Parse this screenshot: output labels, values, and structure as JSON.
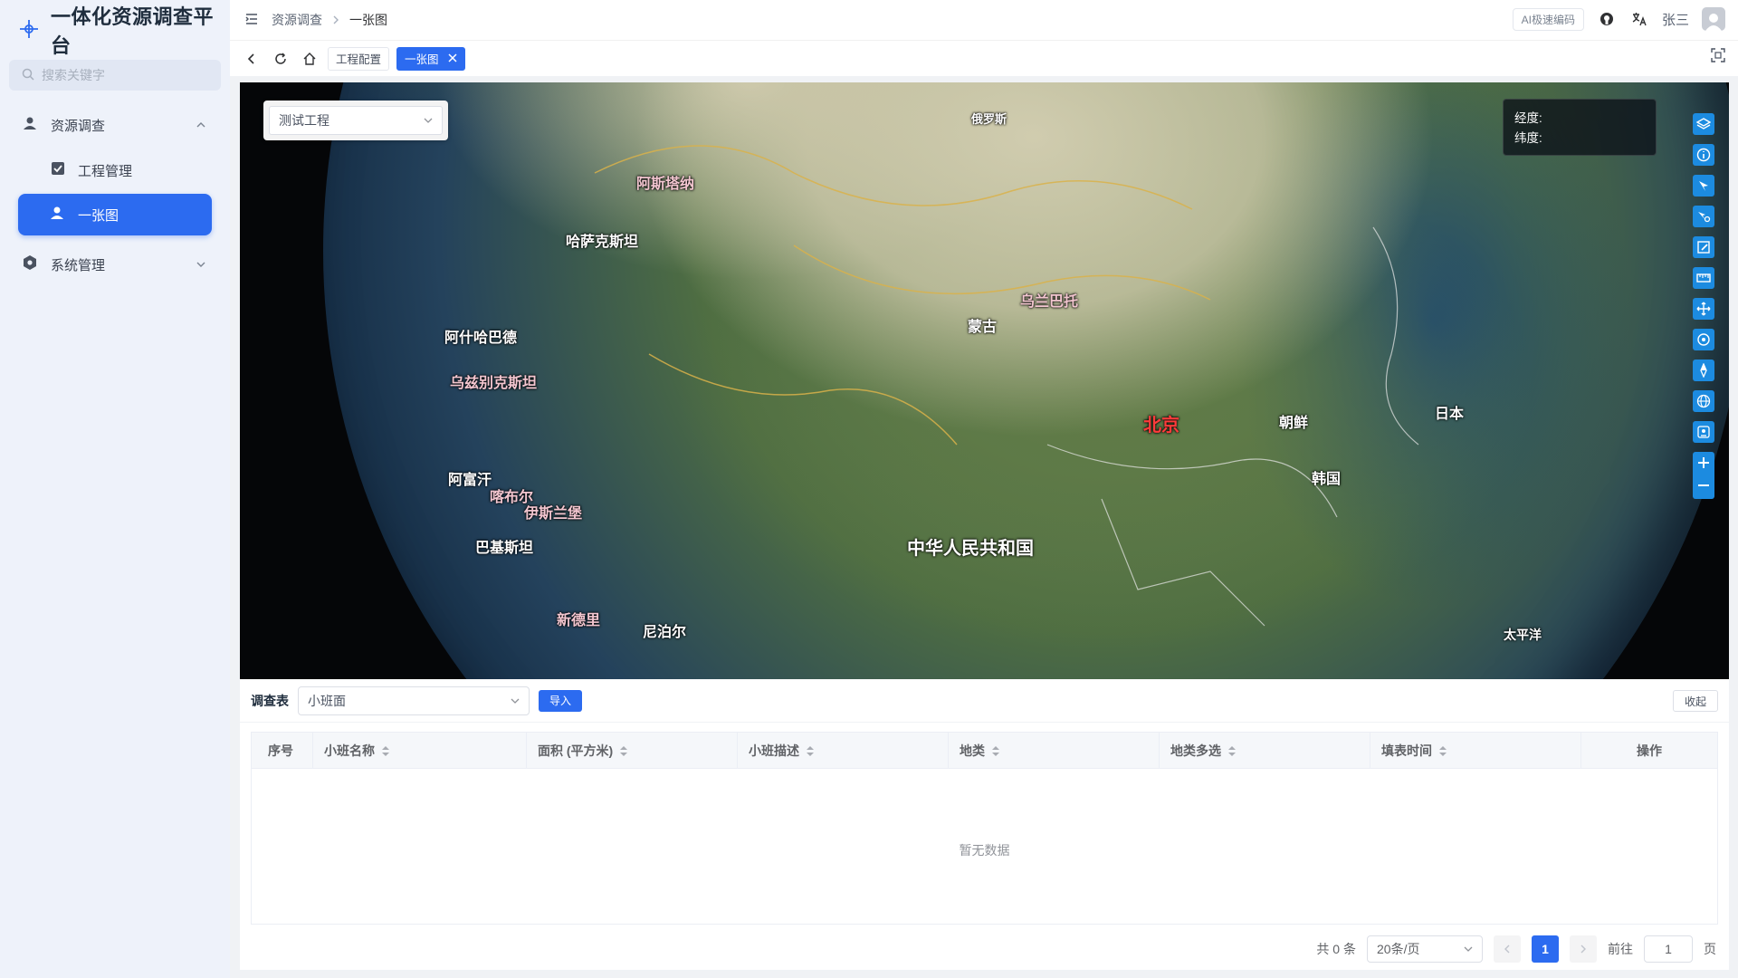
{
  "app": {
    "title": "一体化资源调查平台"
  },
  "sidebar": {
    "search_placeholder": "搜索关键字",
    "items": [
      {
        "label": "资源调查",
        "icon": "user-map-icon"
      },
      {
        "label": "工程管理",
        "icon": "check-square-icon"
      },
      {
        "label": "一张图",
        "icon": "user-map-icon",
        "active": true
      },
      {
        "label": "系统管理",
        "icon": "gear-icon"
      }
    ]
  },
  "header": {
    "breadcrumb": [
      "资源调查",
      "一张图"
    ],
    "ai_badge": "AI极速编码",
    "user_name": "张三"
  },
  "tabs": [
    {
      "label": "工程配置"
    },
    {
      "label": "一张图",
      "active": true
    }
  ],
  "map": {
    "project_select": "测试工程",
    "coords": {
      "lng_label": "经度:",
      "lat_label": "纬度:"
    },
    "labels": [
      {
        "text": "俄罗斯"
      },
      {
        "text": "乌兰巴托"
      },
      {
        "text": "蒙古"
      },
      {
        "text": "北京"
      },
      {
        "text": "朝鲜"
      },
      {
        "text": "韩国"
      },
      {
        "text": "日本"
      },
      {
        "text": "中华人民共和国"
      },
      {
        "text": "尼泊尔"
      },
      {
        "text": "新德里"
      },
      {
        "text": "巴基斯坦"
      },
      {
        "text": "阿富汗"
      },
      {
        "text": "伊斯兰堡"
      },
      {
        "text": "喀布尔"
      },
      {
        "text": "阿斯塔纳"
      },
      {
        "text": "哈萨克斯坦"
      },
      {
        "text": "乌兹别克斯坦"
      },
      {
        "text": "阿什哈巴德"
      },
      {
        "text": "太平洋"
      }
    ]
  },
  "panel": {
    "title": "调查表",
    "select_value": "小班面",
    "import_label": "导入",
    "collapse_label": "收起",
    "columns": [
      "序号",
      "小班名称",
      "面积 (平方米)",
      "小班描述",
      "地类",
      "地类多选",
      "填表时间",
      "操作"
    ],
    "empty_text": "暂无数据"
  },
  "pager": {
    "total": "共 0 条",
    "page_size": "20条/页",
    "current_page": "1",
    "goto_label": "前往",
    "goto_value": "1",
    "page_suffix": "页"
  }
}
